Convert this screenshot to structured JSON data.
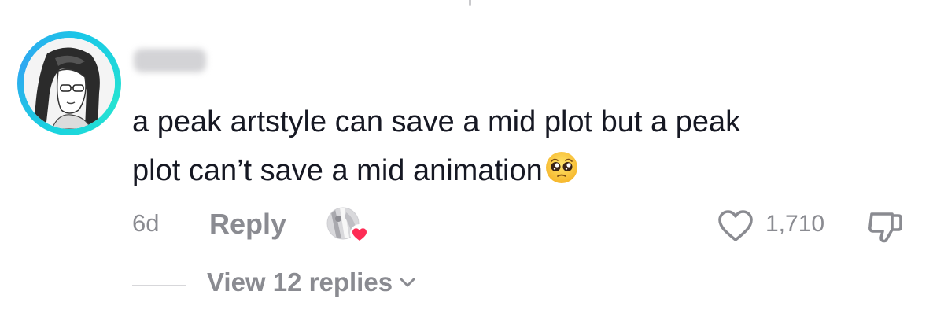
{
  "comment": {
    "author_avatar_icon": "user-avatar-drawing",
    "username_hidden": true,
    "text_line1": "a peak artstyle can save a mid plot but a peak",
    "text_line2": "plot can’t save a mid animation",
    "emoji_icon": "pleading-face-emoji",
    "time_ago": "6d",
    "reply_label": "Reply",
    "liked_by_creator_icon": "creator-liked-heart-icon",
    "like_count": "1,710",
    "view_replies_label": "View 12 replies"
  },
  "colors": {
    "ring_accent": "#19d3df",
    "heart_badge": "#fe2c55",
    "muted_text": "#8a8b91"
  }
}
